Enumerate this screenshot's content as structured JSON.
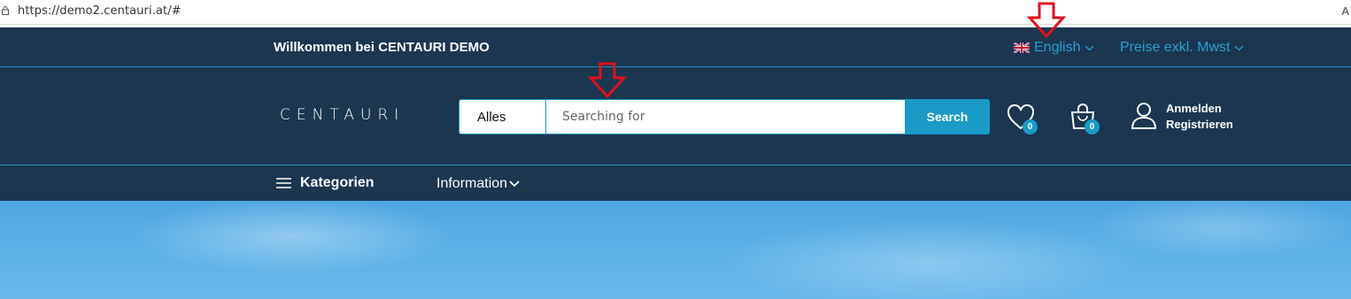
{
  "browser": {
    "url": "https://demo2.centauri.at/#",
    "reader_label": "A"
  },
  "topbar": {
    "welcome": "Willkommen bei CENTAURI DEMO",
    "language": "English",
    "price_mode": "Preise exkl. Mwst"
  },
  "header": {
    "logo": "CENTAURI",
    "search": {
      "category": "Alles",
      "placeholder": "Searching for",
      "button_label": "Search"
    },
    "wishlist_count": "0",
    "cart_count": "0",
    "account": {
      "login": "Anmelden",
      "register": "Registrieren"
    }
  },
  "nav": {
    "categories_label": "Kategorien",
    "information_label": "Information"
  },
  "colors": {
    "header_bg": "#1a3651",
    "accent": "#1a9bc7",
    "link": "#2a9fd4",
    "annotation": "#e0121b"
  }
}
